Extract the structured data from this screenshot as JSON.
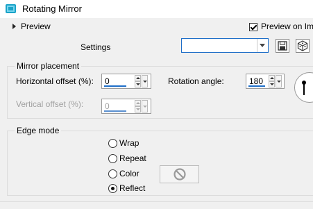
{
  "window": {
    "title": "Rotating Mirror"
  },
  "preview": {
    "label": "Preview",
    "preview_on_image_label": "Preview on Ima",
    "preview_on_image_checked": true
  },
  "settings": {
    "label": "Settings",
    "preset_value": ""
  },
  "mirror_placement": {
    "title": "Mirror placement",
    "horizontal_offset": {
      "label": "Horizontal offset (%):",
      "value": "0"
    },
    "vertical_offset": {
      "label": "Vertical offset (%):",
      "value": "0",
      "enabled": false
    },
    "rotation_angle": {
      "label": "Rotation angle:",
      "value": "180"
    }
  },
  "edge_mode": {
    "title": "Edge mode",
    "options": [
      {
        "label": "Wrap",
        "selected": false
      },
      {
        "label": "Repeat",
        "selected": false
      },
      {
        "label": "Color",
        "selected": false
      },
      {
        "label": "Reflect",
        "selected": true
      }
    ]
  },
  "colors": {
    "accent": "#1e6ec8",
    "app_icon": "#1aa3c8"
  },
  "icons": [
    "app-icon",
    "save-icon",
    "random-icon",
    "no-color-icon",
    "angle-dial-icon"
  ]
}
